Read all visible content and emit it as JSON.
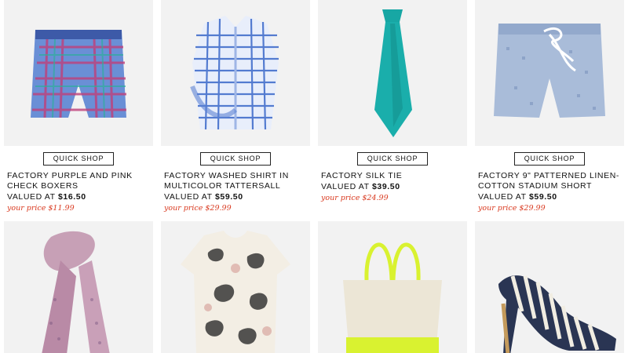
{
  "products_row1": [
    {
      "name": "FACTORY PURPLE AND PINK CHECK BOXERS",
      "valued_prefix": "VALUED AT",
      "valued": "$16.50",
      "your_price": "your price $11.99",
      "quick_shop": "QUICK SHOP",
      "icon": "boxers-icon"
    },
    {
      "name": "FACTORY WASHED SHIRT IN MULTICOLOR TATTERSALL",
      "valued_prefix": "VALUED AT",
      "valued": "$59.50",
      "your_price": "your price $29.99",
      "quick_shop": "QUICK SHOP",
      "icon": "shirt-icon"
    },
    {
      "name": "FACTORY SILK TIE",
      "valued_prefix": "VALUED AT",
      "valued": "$39.50",
      "your_price": "your price $24.99",
      "quick_shop": "QUICK SHOP",
      "icon": "tie-icon"
    },
    {
      "name": "FACTORY 9\" PATTERNED LINEN-COTTON STADIUM SHORT",
      "valued_prefix": "VALUED AT",
      "valued": "$59.50",
      "your_price": "your price $29.99",
      "quick_shop": "QUICK SHOP",
      "icon": "shorts-icon"
    }
  ],
  "products_row2": [
    {
      "icon": "scarf-icon"
    },
    {
      "icon": "floral-top-icon"
    },
    {
      "icon": "tote-bag-icon"
    },
    {
      "icon": "striped-heel-icon"
    }
  ],
  "colors": {
    "price_red": "#d9391f",
    "tile_bg": "#f2f2f2"
  }
}
